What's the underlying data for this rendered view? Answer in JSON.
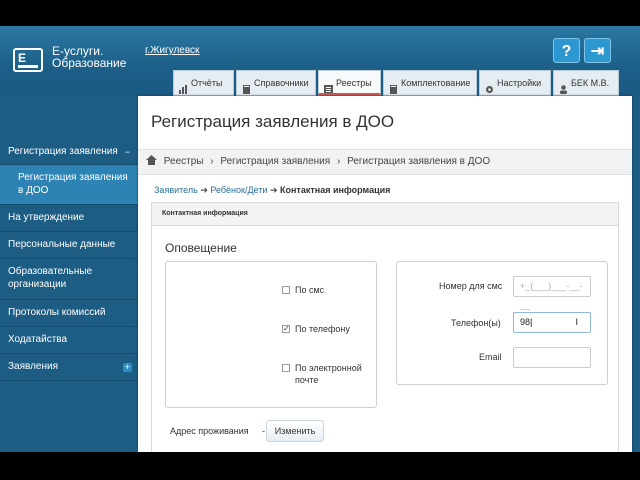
{
  "app": {
    "logo_line1": "Е-услуги.",
    "logo_line2": "Образование",
    "city": "г.Жигулевск",
    "help_icon_glyph": "?",
    "exit_icon_glyph": "⇥"
  },
  "tabs": [
    {
      "label": "Отчёты",
      "icon": "chart-icon"
    },
    {
      "label": "Справочники",
      "icon": "book-icon"
    },
    {
      "label": "Реестры",
      "icon": "list-icon",
      "active": true
    },
    {
      "label": "Комплектование",
      "icon": "book-icon"
    },
    {
      "label": "Настройки",
      "icon": "gear-icon"
    },
    {
      "label": "БЕК М.В.",
      "icon": "user-icon"
    }
  ],
  "sidebar": {
    "items": [
      {
        "label": "Регистрация заявления",
        "marker": "−"
      },
      {
        "label": "Регистрация заявления в ДОО",
        "active": true
      },
      {
        "label": "На утверждение"
      },
      {
        "label": "Персональные данные"
      },
      {
        "label": "Образовательные организации"
      },
      {
        "label": "Протоколы комиссий"
      },
      {
        "label": "Ходатайства"
      },
      {
        "label": "Заявления",
        "marker": "+"
      }
    ]
  },
  "main": {
    "title": "Регистрация заявления в ДОО",
    "breadcrumbs": [
      "Реестры",
      "Регистрация заявления",
      "Регистрация заявления в ДОО"
    ],
    "steps": {
      "step1": "Заявитель",
      "step2": "Ребёнок/Дети",
      "step3": "Контактная информация"
    },
    "panel_title": "Контактная информация",
    "section_title": "Оповещение",
    "options": [
      {
        "label": "По смс",
        "checked": false
      },
      {
        "label": "По телефону",
        "checked": true
      },
      {
        "label": "По электронной почте",
        "checked": false
      }
    ],
    "fields": {
      "sms_label": "Номер для смс",
      "sms_placeholder": "+_(___)___-__-__",
      "phone_label": "Телефон(ы)",
      "phone_value": "98",
      "email_label": "Email",
      "email_value": ""
    },
    "address_label": "Адрес проживания",
    "address_dash": "-",
    "change_button": "Изменить"
  }
}
